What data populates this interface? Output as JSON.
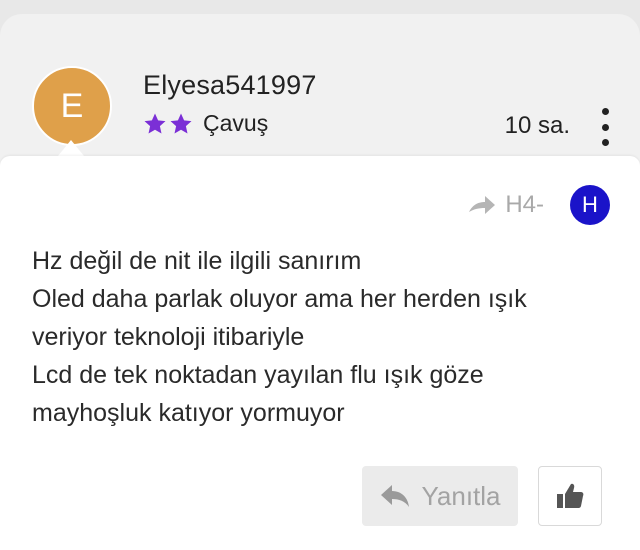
{
  "post": {
    "avatar_letter": "E",
    "avatar_color": "#dfa04a",
    "username": "Elyesa541997",
    "rank": {
      "stars": 2,
      "star_icon": "star-icon",
      "star_color": "#7b2fd6",
      "label": "Çavuş"
    },
    "time": "10 sa.",
    "menu_icon": "vertical-dots-icon",
    "quote": {
      "arrow_icon": "share-arrow-icon",
      "label": "H4-",
      "avatar_letter": "H",
      "avatar_color": "#1a13c9"
    },
    "message_lines": [
      "Hz değil de nit ile ilgili sanırım",
      "Oled daha parlak oluyor ama her herden ışık",
      "veriyor teknoloji itibariyle",
      "Lcd de tek noktadan yayılan flu ışık göze",
      "mayhoşluk katıyor yormuyor"
    ]
  },
  "actions": {
    "reply_label": "Yanıtla",
    "reply_icon": "reply-arrow-icon",
    "like_icon": "thumbs-up-icon"
  }
}
